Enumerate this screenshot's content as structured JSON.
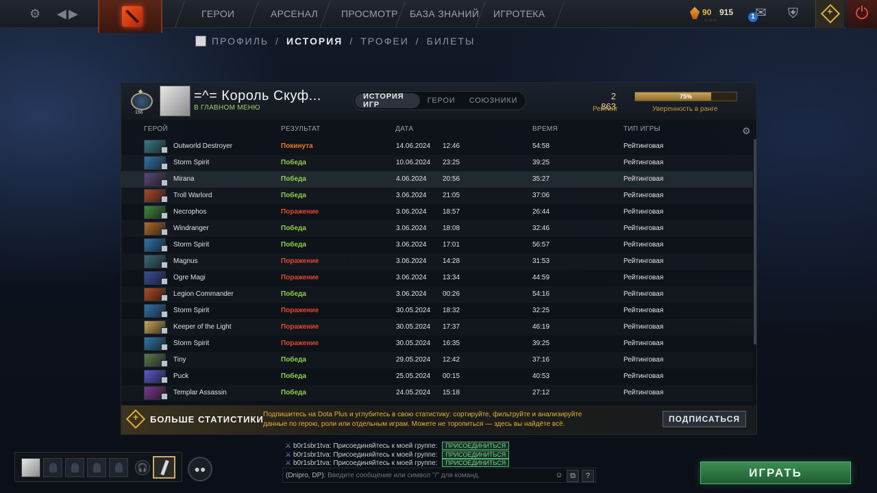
{
  "topbar": {
    "nav": [
      "ГЕРОИ",
      "АРСЕНАЛ",
      "ПРОСМОТР",
      "БАЗА ЗНАНИЙ",
      "ИГРОТЕКА"
    ],
    "currency_main": "90",
    "currency_secondary": "915",
    "mail_count": "1",
    "icons": [
      "settings-icon",
      "back-arrow-icon",
      "forward-arrow-icon",
      "dota-logo",
      "shards-icon",
      "mail-icon",
      "armory-icon",
      "dota-plus-icon",
      "power-icon"
    ]
  },
  "subnav": {
    "items": [
      "ПРОФИЛЬ",
      "ИСТОРИЯ",
      "ТРОФЕИ",
      "БИЛЕТЫ"
    ],
    "active": "ИСТОРИЯ",
    "separator": "/"
  },
  "profile": {
    "name": "=^= Король Скуф...",
    "status": "В ГЛАВНОМ МЕНЮ",
    "tabs": [
      "ИСТОРИЯ ИГР",
      "ГЕРОИ",
      "СОЮЗНИКИ"
    ],
    "active_tab": "ИСТОРИЯ ИГР",
    "rating": "2 863",
    "rating_label": "Рейтинг",
    "confidence_percent": 75,
    "confidence_text": "75%",
    "confidence_label": "Уверенность в ранге",
    "rank_medal_number": "156"
  },
  "table": {
    "headers": {
      "hero": "ГЕРОЙ",
      "result": "РЕЗУЛЬТАТ",
      "date": "ДАТА",
      "duration": "ВРЕМЯ",
      "type": "ТИП ИГРЫ"
    },
    "rows": [
      {
        "hero": "Outworld Destroyer",
        "result": "Покинута",
        "kind": "left",
        "date": "14.06.2024",
        "time": "12:46",
        "duration": "54:58",
        "type": "Рейтинговая",
        "color": "#3a7a86"
      },
      {
        "hero": "Storm Spirit",
        "result": "Победа",
        "kind": "win",
        "date": "10.06.2024",
        "time": "23:25",
        "duration": "39:25",
        "type": "Рейтинговая",
        "color": "#2f74a8"
      },
      {
        "hero": "Mirana",
        "result": "Победа",
        "kind": "win",
        "date": "4.06.2024",
        "time": "20:56",
        "duration": "35:27",
        "type": "Рейтинговая",
        "color": "#5a4a78"
      },
      {
        "hero": "Troll Warlord",
        "result": "Победа",
        "kind": "win",
        "date": "3.06.2024",
        "time": "21:05",
        "duration": "37:06",
        "type": "Рейтинговая",
        "color": "#a84a2a"
      },
      {
        "hero": "Necrophos",
        "result": "Поражение",
        "kind": "loss",
        "date": "3.06.2024",
        "time": "18:57",
        "duration": "26:44",
        "type": "Рейтинговая",
        "color": "#3f8a3a"
      },
      {
        "hero": "Windranger",
        "result": "Победа",
        "kind": "win",
        "date": "3.06.2024",
        "time": "18:08",
        "duration": "32:46",
        "type": "Рейтинговая",
        "color": "#b06a2a"
      },
      {
        "hero": "Storm Spirit",
        "result": "Победа",
        "kind": "win",
        "date": "3.06.2024",
        "time": "17:01",
        "duration": "56:57",
        "type": "Рейтинговая",
        "color": "#2f74a8"
      },
      {
        "hero": "Magnus",
        "result": "Поражение",
        "kind": "loss",
        "date": "3.06.2024",
        "time": "14:28",
        "duration": "31:53",
        "type": "Рейтинговая",
        "color": "#3a6a7a"
      },
      {
        "hero": "Ogre Magi",
        "result": "Поражение",
        "kind": "loss",
        "date": "3.06.2024",
        "time": "13:34",
        "duration": "44:59",
        "type": "Рейтинговая",
        "color": "#3a4f9a"
      },
      {
        "hero": "Legion Commander",
        "result": "Победа",
        "kind": "win",
        "date": "3.06.2024",
        "time": "00:26",
        "duration": "54:16",
        "type": "Рейтинговая",
        "color": "#b04a22"
      },
      {
        "hero": "Storm Spirit",
        "result": "Поражение",
        "kind": "loss",
        "date": "30.05.2024",
        "time": "18:32",
        "duration": "32:25",
        "type": "Рейтинговая",
        "color": "#2f74a8"
      },
      {
        "hero": "Keeper of the Light",
        "result": "Поражение",
        "kind": "loss",
        "date": "30.05.2024",
        "time": "17:37",
        "duration": "46:19",
        "type": "Рейтинговая",
        "color": "#c8a858"
      },
      {
        "hero": "Storm Spirit",
        "result": "Поражение",
        "kind": "loss",
        "date": "30.05.2024",
        "time": "16:35",
        "duration": "39:25",
        "type": "Рейтинговая",
        "color": "#2f74a8"
      },
      {
        "hero": "Tiny",
        "result": "Победа",
        "kind": "win",
        "date": "29.05.2024",
        "time": "12:42",
        "duration": "37:16",
        "type": "Рейтинговая",
        "color": "#5a7a4a"
      },
      {
        "hero": "Puck",
        "result": "Победа",
        "kind": "win",
        "date": "25.05.2024",
        "time": "00:15",
        "duration": "40:53",
        "type": "Рейтинговая",
        "color": "#5a5ad0"
      },
      {
        "hero": "Templar Assassin",
        "result": "Победа",
        "kind": "win",
        "date": "24.05.2024",
        "time": "15:18",
        "duration": "27:12",
        "type": "Рейтинговая",
        "color": "#7a3a8a"
      }
    ]
  },
  "promo": {
    "title": "БОЛЬШЕ СТАТИСТИКИ",
    "text": "Подпишитесь на Dota Plus и углубитесь в свою статистику: сортируйте, фильтруйте и анализируйте данные по герою, роли или отдельным играм. Можете не торопиться — здесь вы найдёте всё.",
    "button": "ПОДПИСАТЬСЯ"
  },
  "chat": {
    "messages": [
      {
        "user": "b0r1sbr1tva",
        "text": "Присоединяйтесь к моей группе:",
        "button": "ПРИСОЕДИНИТЬСЯ"
      },
      {
        "user": "b0r1sbr1tva",
        "text": "Присоединяйтесь к моей группе:",
        "button": "ПРИСОЕДИНИТЬСЯ"
      },
      {
        "user": "b0r1sbr1tva",
        "text": "Присоединяйтесь к моей группе:",
        "button": "ПРИСОЕДИНИТЬСЯ"
      }
    ],
    "channel": "(Dnipro, DP):",
    "placeholder": "Введите сообщение или символ \"/\" для команд."
  },
  "play_button": "ИГРАТЬ"
}
